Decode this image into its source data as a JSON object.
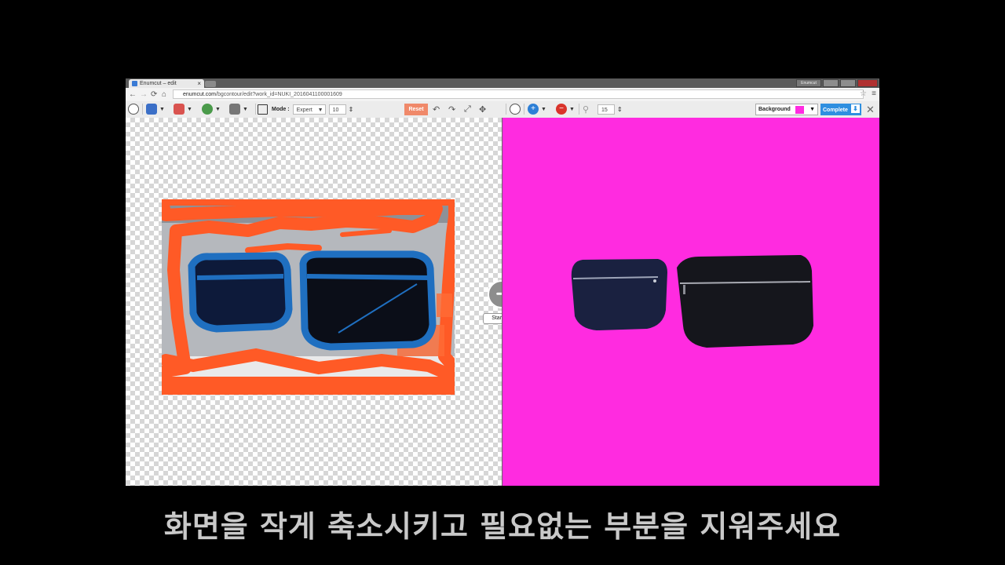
{
  "browser": {
    "tab_title": "Enumcut – edit",
    "tab_close": "×",
    "url_domain": "enumcut.com",
    "url_path": "/bgcontour/edit?work_id=NUKI_2016041100001609",
    "user_button": "Enumcut",
    "nav": {
      "back": "←",
      "forward": "→",
      "reload": "⟳",
      "home": "⌂",
      "star": "☆",
      "menu": "≡"
    }
  },
  "toolbar": {
    "mode_label": "Mode :",
    "mode_value": "Expert",
    "brush_size_left": "10",
    "reset_label": "Reset",
    "brush_size_right": "15",
    "background_label": "Background",
    "background_color": "#ff2be0",
    "complete_label": "Complete",
    "close_glyph": "✕",
    "icons": [
      "pen-icon",
      "person-icon",
      "bag-icon",
      "plant-icon",
      "eraser-icon",
      "crop-icon",
      "undo-icon",
      "redo-icon",
      "fit-icon",
      "move-icon",
      "add-icon",
      "remove-icon",
      "magnify-icon",
      "download-icon"
    ]
  },
  "canvas": {
    "start_cut_label": "Start Cut",
    "result_background": "#ff2be0"
  },
  "subtitle": "화면을 작게 축소시키고 필요없는 부분을 지워주세요"
}
